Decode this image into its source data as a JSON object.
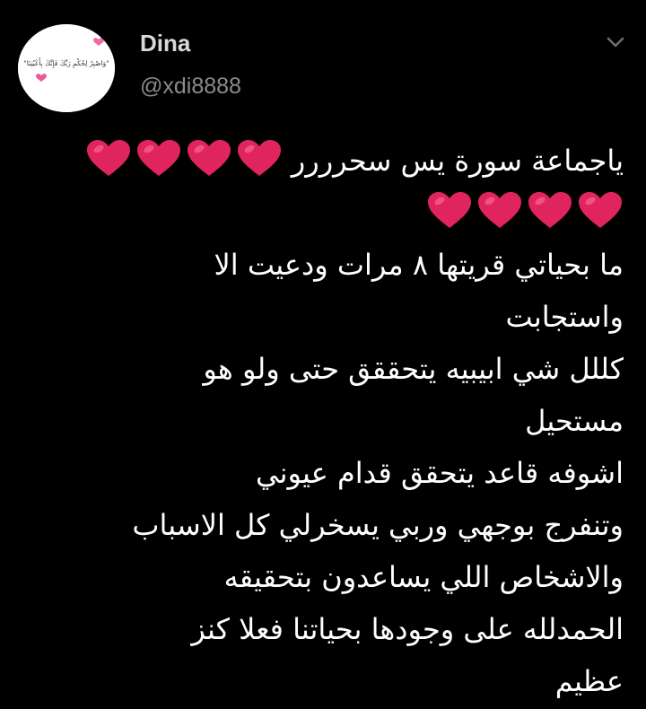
{
  "tweet": {
    "author": {
      "display_name": "Dina",
      "handle": "@xdi8888",
      "avatar_text": "\"وَاصْبِرْ لِحُكْمِ رَبِّكَ فَإِنَّكَ بِأَعْيُنِنَا\""
    },
    "menu_icon": "chevron-down-icon",
    "lines": [
      {
        "text": "ياجماعة سورة يس سحرررر",
        "hearts": 4
      },
      {
        "text": "",
        "hearts": 4
      },
      {
        "text": "ما بحياتي قريتها ٨ مرات ودعيت الا",
        "hearts": 0
      },
      {
        "text": "واستجابت",
        "hearts": 0
      },
      {
        "text": "كللل شي ابيبيه يتحققق حتى ولو هو",
        "hearts": 0
      },
      {
        "text": "مستحيل",
        "hearts": 0
      },
      {
        "text": "اشوفه قاعد يتحقق قدام عيوني",
        "hearts": 0
      },
      {
        "text": "وتنفرج بوجهي وربي يسخرلي كل الاسباب",
        "hearts": 0
      },
      {
        "text": "والاشخاص اللي يساعدون بتحقيقه",
        "hearts": 0
      },
      {
        "text": "الحمدلله على وجودها بحياتنا فعلا كنز",
        "hearts": 0
      },
      {
        "text": "عظيم",
        "hearts": 0
      }
    ],
    "heart_color": "#e0245e",
    "heart_icon": "red-heart-icon"
  }
}
